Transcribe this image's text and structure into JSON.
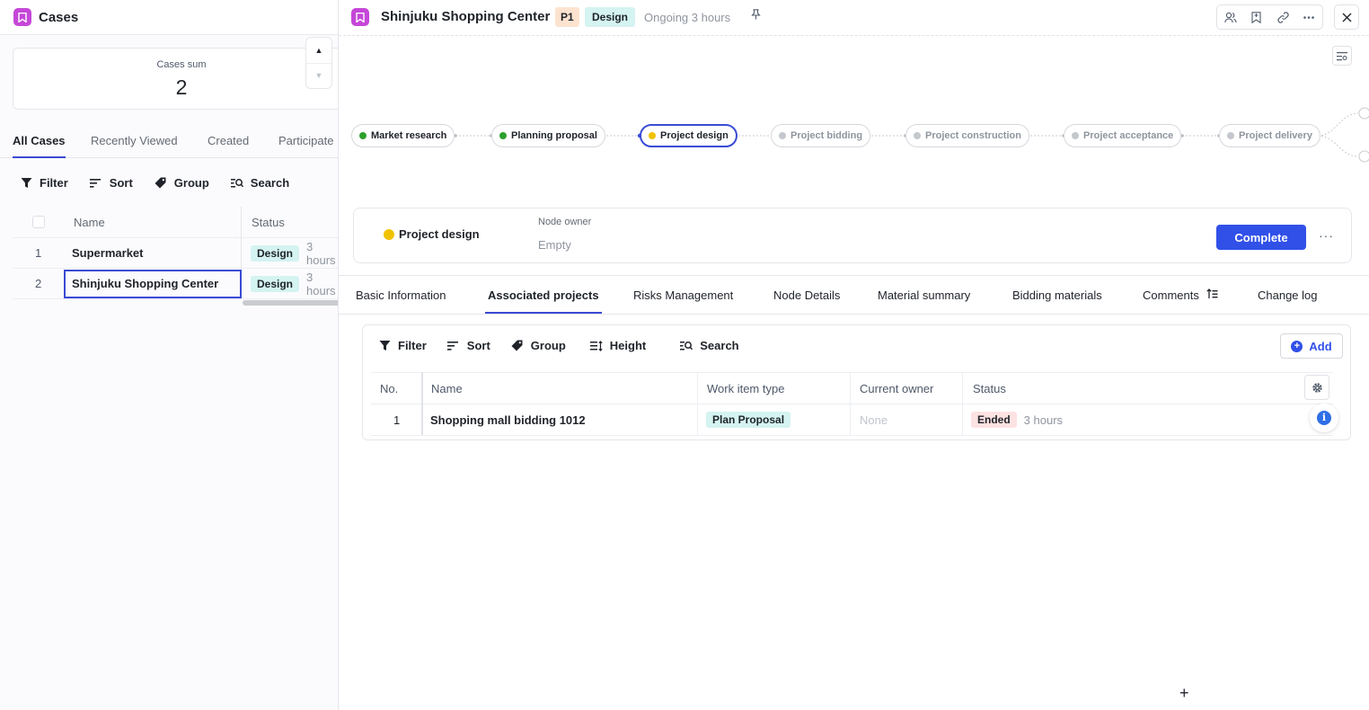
{
  "left": {
    "title": "Cases",
    "summary": {
      "label": "Cases sum",
      "value": "2"
    },
    "view_tabs": [
      "All Cases",
      "Recently Viewed",
      "Created",
      "Participate"
    ],
    "toolbar": {
      "filter": "Filter",
      "sort": "Sort",
      "group": "Group",
      "search": "Search"
    },
    "table": {
      "columns": {
        "name": "Name",
        "status": "Status"
      },
      "rows": [
        {
          "no": "1",
          "name": "Supermarket",
          "status": "Design",
          "time": "3 hours"
        },
        {
          "no": "2",
          "name": "Shinjuku Shopping Center",
          "status": "Design",
          "time": "3 hours"
        }
      ]
    }
  },
  "detail": {
    "title": "Shinjuku Shopping Center",
    "priority": "P1",
    "stage": "Design",
    "ongoing": "Ongoing 3 hours",
    "flow": [
      {
        "label": "Market research",
        "state": "done"
      },
      {
        "label": "Planning proposal",
        "state": "done"
      },
      {
        "label": "Project design",
        "state": "current"
      },
      {
        "label": "Project bidding",
        "state": "pending"
      },
      {
        "label": "Project construction",
        "state": "pending"
      },
      {
        "label": "Project acceptance",
        "state": "pending"
      },
      {
        "label": "Project delivery",
        "state": "pending"
      }
    ],
    "node_card": {
      "title": "Project design",
      "owner_label": "Node owner",
      "owner_value": "Empty",
      "complete_label": "Complete"
    },
    "tabs": [
      "Basic Information",
      "Associated projects",
      "Risks Management",
      "Node Details",
      "Material summary",
      "Bidding materials",
      "Comments",
      "Change log"
    ],
    "sub_toolbar": {
      "filter": "Filter",
      "sort": "Sort",
      "group": "Group",
      "height": "Height",
      "search": "Search",
      "add": "Add"
    },
    "sub_table": {
      "columns": {
        "no": "No.",
        "name": "Name",
        "type": "Work item type",
        "owner": "Current owner",
        "status": "Status"
      },
      "rows": [
        {
          "no": "1",
          "name": "Shopping mall bidding 1012",
          "type": "Plan Proposal",
          "owner": "None",
          "status": "Ended",
          "time": "3 hours"
        }
      ]
    }
  },
  "colors": {
    "accent": "#3a4bd4",
    "primary_button": "#3150e8",
    "app_icon": "#c547d8",
    "done": "#2ca02c",
    "current": "#f0c200",
    "pending": "#c4c7cc"
  }
}
